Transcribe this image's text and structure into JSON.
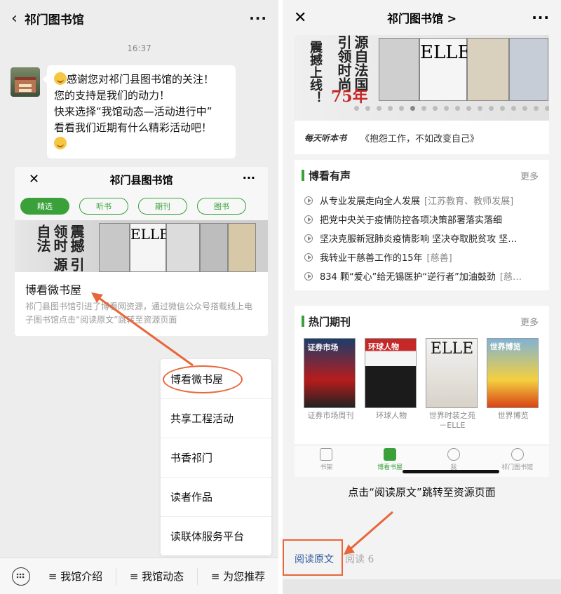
{
  "left": {
    "nav": {
      "title": "祁门图书馆",
      "back_icon": "back-arrow-icon",
      "more_icon": "more-dots-icon"
    },
    "time": "16:37",
    "message": {
      "line1": "感谢您对祁门县图书馆的关注！",
      "line2": "您的支持是我们的动力！",
      "line3": "快来选择“我馆动态—活动进行中”",
      "line4": "看看我们近期有什么精彩活动吧！"
    },
    "card": {
      "header": "祁门县图书馆",
      "chips": [
        "精选",
        "听书",
        "期刊",
        "图书"
      ],
      "banner_text": "震撼 引领时 源自法",
      "title": "博看微书屋",
      "desc": "祁门县图书馆引进了博看网资源，通过微信公众号搭载线上电子图书馆点击“阅读原文”跳转至资源页面"
    },
    "menu": [
      "博看微书屋",
      "共享工程活动",
      "书香祁门",
      "读者作品",
      "读联体服务平台"
    ],
    "bottom_tabs": [
      "≡ 我馆介绍",
      "≡ 我馆动态",
      "≡ 为您推荐"
    ]
  },
  "right": {
    "nav": {
      "title": "祁门图书馆 >"
    },
    "banner": {
      "col1": "震撼上线！",
      "col2": "引领时尚",
      "col3": "源自法国",
      "pct": "75年"
    },
    "listen": {
      "logo": "每天听本书",
      "text": "《抱怨工作，不如改变自己》"
    },
    "audio_section": {
      "title": "博看有声",
      "more": "更多",
      "items": [
        {
          "title": "从专业发展走向全人发展",
          "tag": "[江苏教育、教师发展]"
        },
        {
          "title": "把党中央关于疫情防控各项决策部署落实落细",
          "tag": ""
        },
        {
          "title": "坚决克服新冠肺炎疫情影响 坚决夺取脱贫攻 坚…",
          "tag": ""
        },
        {
          "title": "我转业干慈善工作的15年",
          "tag": "[慈善]"
        },
        {
          "title": "834 颗“爱心”给无锡医护“逆行者”加油鼓劲",
          "tag": "[慈…"
        }
      ]
    },
    "magazine_section": {
      "title": "热门期刊",
      "more": "更多",
      "items": [
        {
          "name": "证券市场周刊",
          "cover_text": "证券市场",
          "color": "#b71c1c"
        },
        {
          "name": "环球人物",
          "cover_text": "环球人物",
          "color": "#c62828"
        },
        {
          "name": "世界时装之苑－ELLE",
          "cover_text": "ELLE",
          "color": "#e0e0e0"
        },
        {
          "name": "世界博览",
          "cover_text": "世界博览",
          "color": "#d84315"
        }
      ]
    },
    "tabs": [
      "书架",
      "博看书屋",
      "我",
      "祁门图书馆"
    ],
    "caption": "点击“阅读原文”跳转至资源页面",
    "read_original": "阅读原文",
    "read_count": "阅读 6"
  },
  "colors": {
    "accent": "#3aa13a",
    "highlight": "#e8663a",
    "link": "#2f5c9e"
  }
}
